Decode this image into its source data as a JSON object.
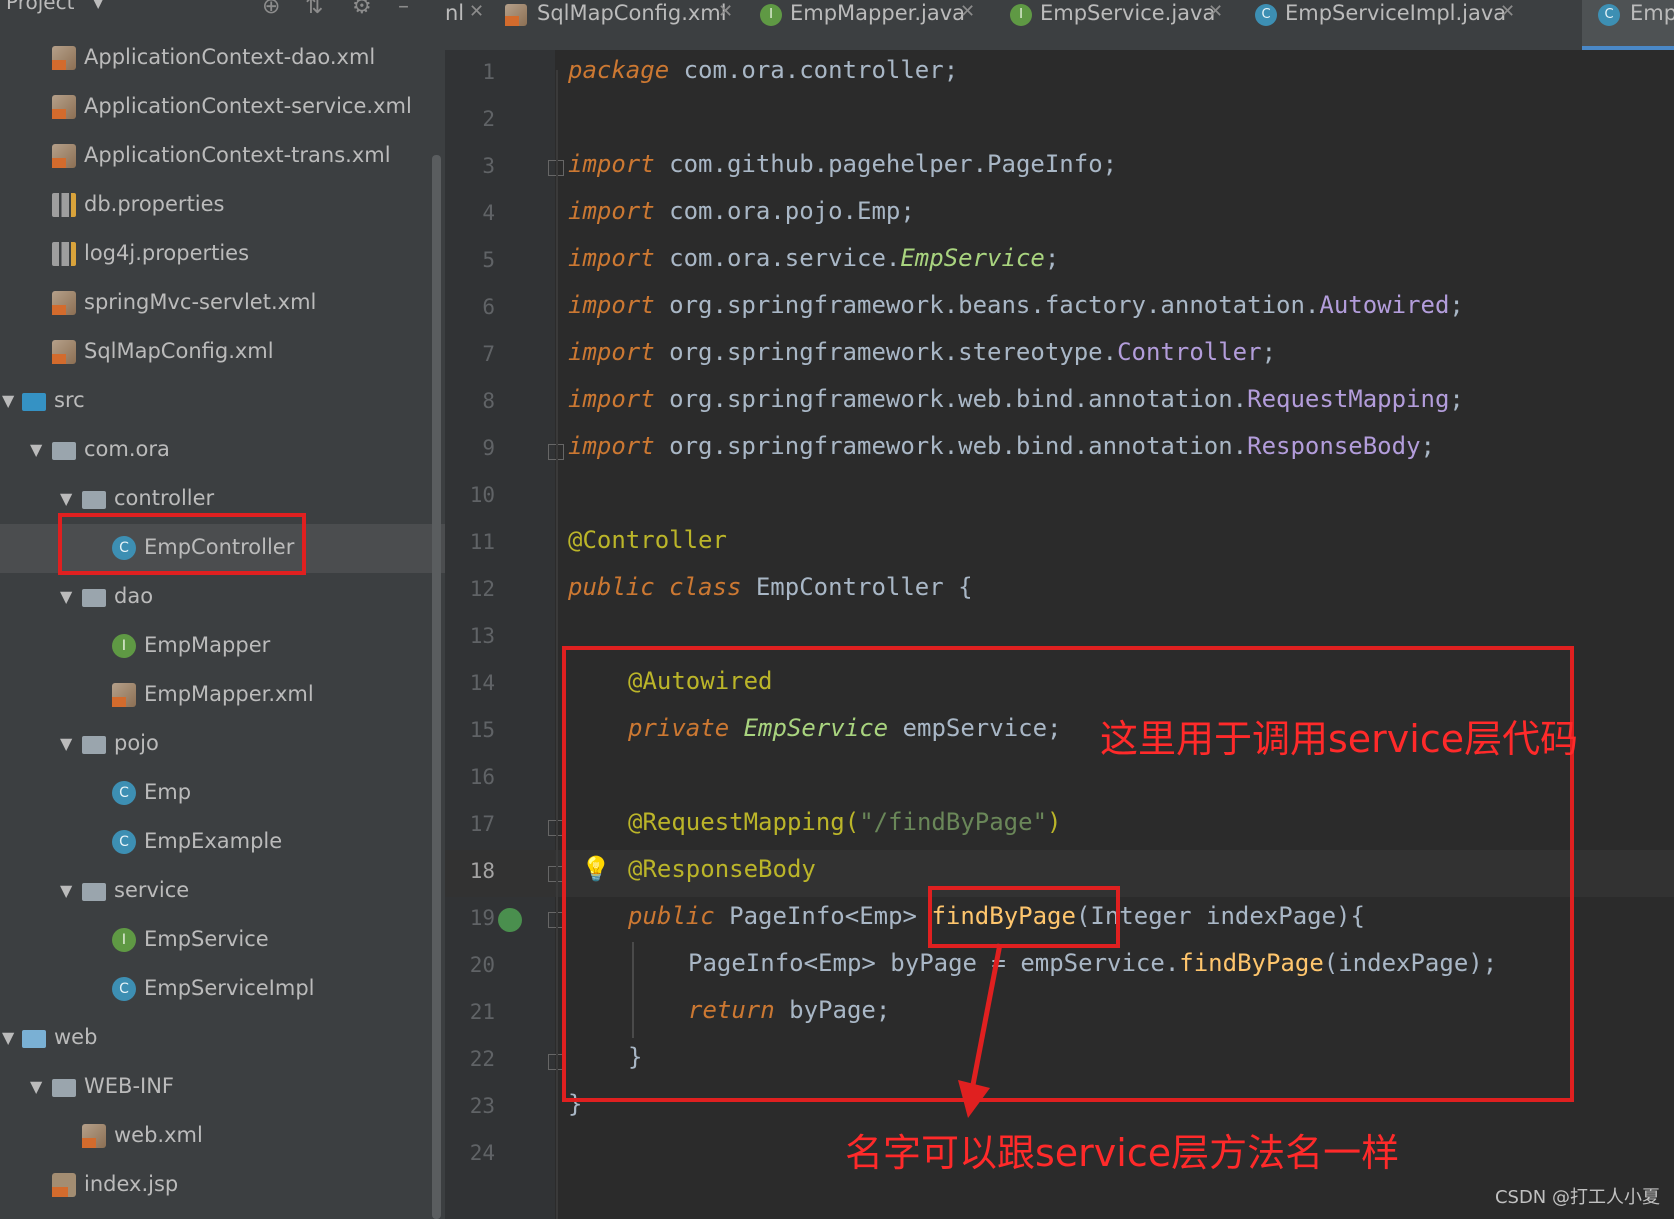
{
  "project_panel": {
    "title": "Project",
    "items": [
      {
        "label": "ApplicationContext-dao.xml",
        "type": "xml"
      },
      {
        "label": "ApplicationContext-service.xml",
        "type": "xml"
      },
      {
        "label": "ApplicationContext-trans.xml",
        "type": "xml"
      },
      {
        "label": "db.properties",
        "type": "properties"
      },
      {
        "label": "log4j.properties",
        "type": "properties"
      },
      {
        "label": "springMvc-servlet.xml",
        "type": "xml"
      },
      {
        "label": "SqlMapConfig.xml",
        "type": "xml"
      },
      {
        "label": "src",
        "type": "folder"
      },
      {
        "label": "com.ora",
        "type": "package"
      },
      {
        "label": "controller",
        "type": "package"
      },
      {
        "label": "EmpController",
        "type": "class"
      },
      {
        "label": "dao",
        "type": "package"
      },
      {
        "label": "EmpMapper",
        "type": "interface"
      },
      {
        "label": "EmpMapper.xml",
        "type": "xml"
      },
      {
        "label": "pojo",
        "type": "package"
      },
      {
        "label": "Emp",
        "type": "class"
      },
      {
        "label": "EmpExample",
        "type": "class"
      },
      {
        "label": "service",
        "type": "package"
      },
      {
        "label": "EmpService",
        "type": "interface"
      },
      {
        "label": "EmpServiceImpl",
        "type": "class"
      },
      {
        "label": "web",
        "type": "folder"
      },
      {
        "label": "WEB-INF",
        "type": "folder"
      },
      {
        "label": "web.xml",
        "type": "xml"
      },
      {
        "label": "index.jsp",
        "type": "jsp"
      }
    ],
    "class_letter": "C",
    "interface_letter": "I"
  },
  "tabs": [
    {
      "label": "nl"
    },
    {
      "label": "SqlMapConfig.xml"
    },
    {
      "label": "EmpMapper.java"
    },
    {
      "label": "EmpService.java"
    },
    {
      "label": "EmpServiceImpl.java"
    },
    {
      "label": "Emp"
    }
  ],
  "editor": {
    "line_numbers": [
      "1",
      "2",
      "3",
      "4",
      "5",
      "6",
      "7",
      "8",
      "9",
      "10",
      "11",
      "12",
      "13",
      "14",
      "15",
      "16",
      "17",
      "18",
      "19",
      "20",
      "21",
      "22",
      "23",
      "24"
    ],
    "current_line": "18",
    "code": {
      "l1_kw": "package",
      "l1_rest": " com.ora.controller;",
      "imp": "import",
      "l3_a": " com.github.pagehelper.",
      "l3_b": "PageInfo",
      "l3_c": ";",
      "l4": " com.ora.pojo.Emp;",
      "l5_a": " com.ora.service.",
      "l5_b": "EmpService",
      "l5_c": ";",
      "l6_a": " org.springframework.beans.factory.annotation.",
      "l6_b": "Autowired",
      "l6_c": ";",
      "l7_a": " org.springframework.stereotype.",
      "l7_b": "Controller",
      "l7_c": ";",
      "l8_a": " org.springframework.web.bind.annotation.",
      "l8_b": "RequestMapping",
      "l8_c": ";",
      "l9_a": " org.springframework.web.bind.annotation.",
      "l9_b": "ResponseBody",
      "l9_c": ";",
      "l11": "@Controller",
      "l12_a": "public",
      "l12_b": "class",
      "l12_c": " EmpController {",
      "l14": "@Autowired",
      "l15_a": "private",
      "l15_b": " EmpService",
      "l15_c": " empService;",
      "l17_a": "@RequestMapping(",
      "l17_b": "\"/findByPage\"",
      "l17_c": ")",
      "l18": "@ResponseBody",
      "l19_a": "public",
      "l19_b": " PageInfo<Emp> ",
      "l19_c": "findByPage",
      "l19_d": "(Integer indexPage){",
      "l20_a": "PageInfo<Emp> byPage = empService.",
      "l20_b": "findByPage",
      "l20_c": "(indexPage);",
      "l21_a": "return",
      "l21_b": " byPage;",
      "l22": "}",
      "l23": "}"
    }
  },
  "annotations": {
    "note1": "这里用于调用service层代码",
    "note2": "名字可以跟service层方法名一样"
  },
  "watermark": "CSDN @打工人小夏",
  "colors": {
    "annotation_red": "#e02020",
    "keyword": "#cc7832",
    "annotation": "#bbb529",
    "method": "#ffc66d"
  }
}
